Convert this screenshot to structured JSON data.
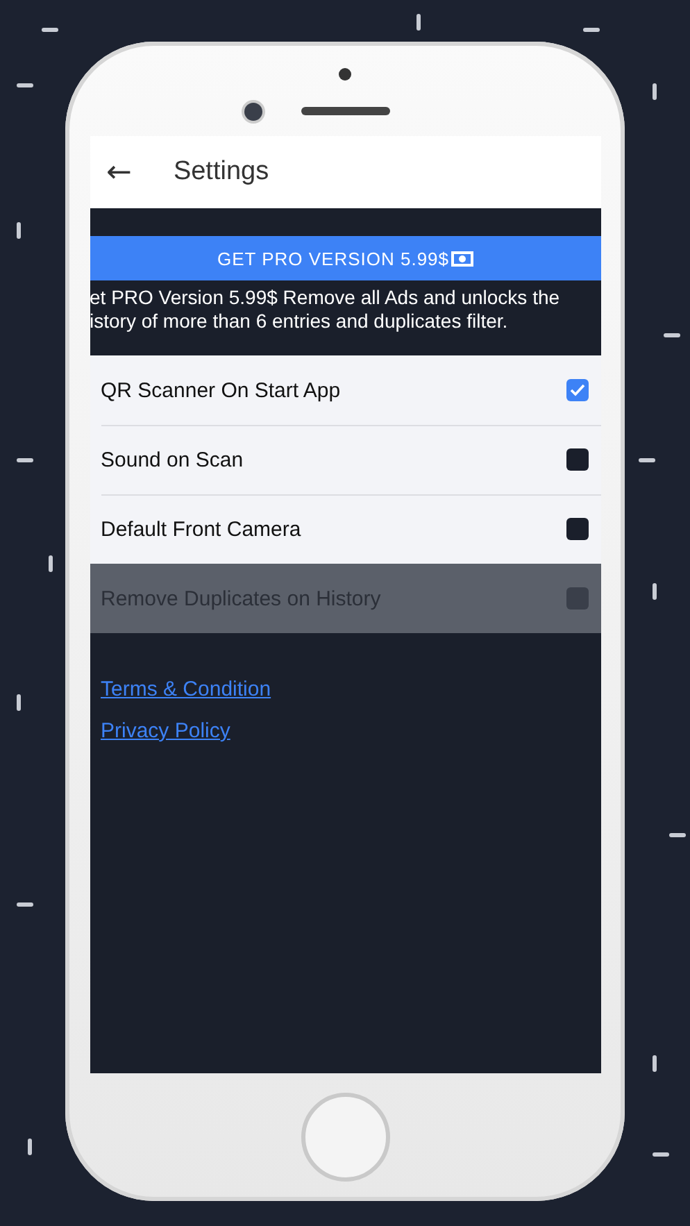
{
  "header": {
    "back": "←",
    "title": "Settings"
  },
  "pro_button": {
    "label": "GET PRO VERSION 5.99$"
  },
  "promo_lines": [
    "et PRO Version 5.99$ Remove all Ads and unlocks the",
    "istory of more than 6 entries and duplicates filter."
  ],
  "settings": [
    {
      "label": "QR Scanner On Start App",
      "checked": true,
      "disabled": false
    },
    {
      "label": "Sound on Scan",
      "checked": false,
      "disabled": false
    },
    {
      "label": "Default Front Camera",
      "checked": false,
      "disabled": false
    },
    {
      "label": "Remove Duplicates on History",
      "checked": false,
      "disabled": true
    }
  ],
  "links": [
    "Terms & Condition",
    "Privacy Policy"
  ]
}
